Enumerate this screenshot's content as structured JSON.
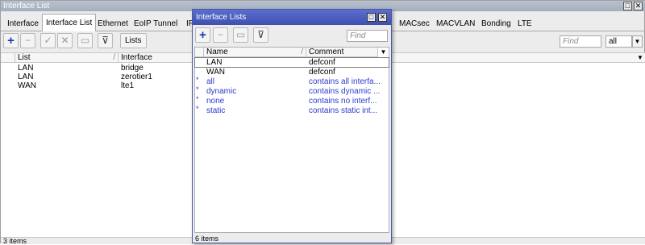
{
  "window": {
    "title": "Interface List"
  },
  "tabs": [
    "Interface",
    "Interface List",
    "Ethernet",
    "EoIP Tunnel",
    "IP",
    "MACsec",
    "MACVLAN",
    "Bonding",
    "LTE"
  ],
  "toolbar": {
    "lists_label": "Lists",
    "find_placeholder": "Find",
    "filter_value": "all"
  },
  "table": {
    "columns": [
      "List",
      "Interface"
    ],
    "rows": [
      {
        "list": "LAN",
        "interface": "bridge"
      },
      {
        "list": "LAN",
        "interface": "zerotier1"
      },
      {
        "list": "WAN",
        "interface": "lte1"
      }
    ]
  },
  "status": "3 items",
  "dialog": {
    "title": "Interface Lists",
    "find_placeholder": "Find",
    "columns": [
      "Name",
      "Comment"
    ],
    "rows": [
      {
        "marker": "",
        "name": "LAN",
        "comment": "defconf",
        "dynamic": false
      },
      {
        "marker": "",
        "name": "WAN",
        "comment": "defconf",
        "dynamic": false
      },
      {
        "marker": "*",
        "name": "all",
        "comment": "contains all interfa...",
        "dynamic": true
      },
      {
        "marker": "*",
        "name": "dynamic",
        "comment": "contains dynamic ...",
        "dynamic": true
      },
      {
        "marker": "*",
        "name": "none",
        "comment": "contains no interf...",
        "dynamic": true
      },
      {
        "marker": "*",
        "name": "static",
        "comment": "contains static int...",
        "dynamic": true
      }
    ],
    "status": "6 items"
  },
  "colors": {
    "title_bar": "#a3aebd",
    "dialog_title": "#3e4fae",
    "dynamic_text": "#2b3bcc",
    "add_icon": "#1a37b0"
  },
  "icons": [
    "add-icon",
    "remove-icon",
    "enable-icon",
    "disable-icon",
    "comment-icon",
    "filter-icon",
    "restore-icon",
    "close-icon"
  ]
}
